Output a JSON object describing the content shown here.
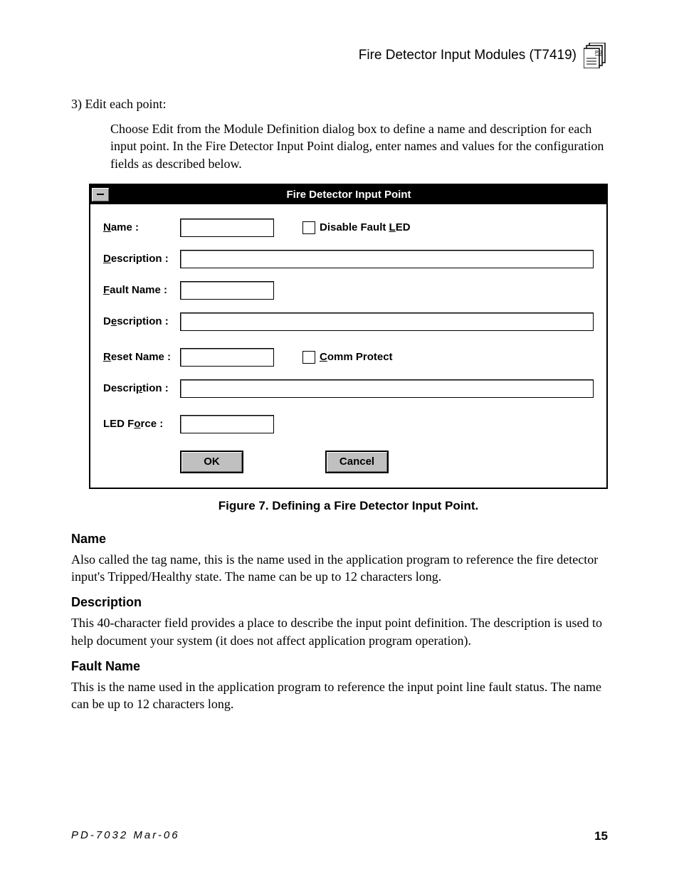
{
  "header": {
    "title": "Fire Detector Input Modules (T7419)"
  },
  "step": {
    "num": "3) Edit each point:",
    "text": "Choose Edit from the Module Definition dialog box to define a name and description for each input point.  In the Fire Detector Input Point dialog, enter names and values for the configuration fields as described below."
  },
  "dialog": {
    "title": "Fire Detector Input Point",
    "labels": {
      "name_pre": "N",
      "name_post": "ame :",
      "desc1_pre": "D",
      "desc1_post": "escription :",
      "fault_pre": "F",
      "fault_post": "ault Name :",
      "desc2_pre": "D",
      "desc2_mid": "e",
      "desc2_post": "scription :",
      "reset_pre": "R",
      "reset_post": "eset Name :",
      "desc3_pre": "Descri",
      "desc3_mid": "p",
      "desc3_post": "tion :",
      "ledforce_pre": "LED F",
      "ledforce_mid": "o",
      "ledforce_post": "rce :",
      "disable_pre": "Disable Fault ",
      "disable_mid": "L",
      "disable_post": "ED",
      "comm_pre": "C",
      "comm_post": "omm Protect"
    },
    "buttons": {
      "ok": "OK",
      "cancel": "Cancel"
    }
  },
  "figure_caption": "Figure 7.  Defining a Fire Detector Input Point.",
  "sections": {
    "name": {
      "heading": "Name",
      "text": "Also called the tag name, this is the name used in the application program to reference the fire detector input's Tripped/Healthy state.  The name can be up to 12 characters long."
    },
    "description": {
      "heading": "Description",
      "text": "This 40-character field provides a place to describe the input point definition.  The description is used to help document your system (it does not affect application program operation)."
    },
    "fault": {
      "heading": "Fault Name",
      "text": "This is the name used in the application program to reference the input point line fault status.  The name can be up to 12 characters long."
    }
  },
  "footer": {
    "left": "PD-7032 Mar-06",
    "right": "15"
  }
}
